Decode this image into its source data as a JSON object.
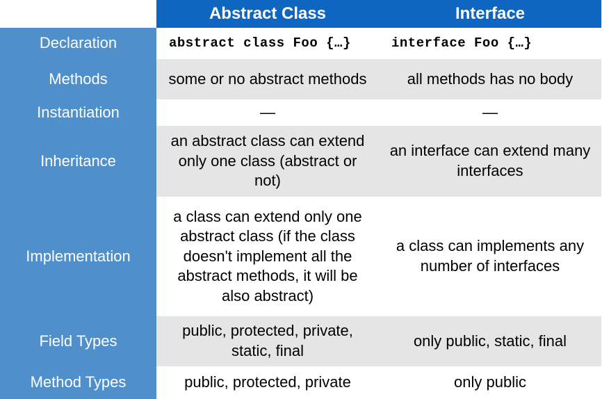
{
  "columns": {
    "c1": "Abstract Class",
    "c2": "Interface"
  },
  "rows": {
    "declaration": {
      "label": "Declaration",
      "c1": "abstract class Foo {…}",
      "c2": "interface Foo {…}"
    },
    "methods": {
      "label": "Methods",
      "c1": "some or no abstract methods",
      "c2": "all methods has no body"
    },
    "instantiation": {
      "label": "Instantiation",
      "c1": "—",
      "c2": "—"
    },
    "inheritance": {
      "label": "Inheritance",
      "c1": "an abstract class can extend only one class (abstract or not)",
      "c2": "an interface can extend many interfaces"
    },
    "implementation": {
      "label": "Implementation",
      "c1": "a class can extend only one abstract class (if the class doesn't implement all the abstract methods, it will be also abstract)",
      "c2": "a class can implements any number of interfaces"
    },
    "fieldtypes": {
      "label": "Field Types",
      "c1": "public, protected, private, static, final",
      "c2": "only public, static, final"
    },
    "methodtypes": {
      "label": "Method Types",
      "c1": "public, protected, private",
      "c2": "only public"
    }
  }
}
